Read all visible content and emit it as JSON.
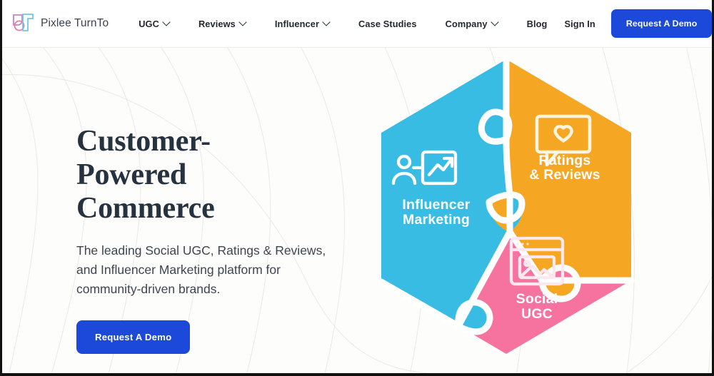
{
  "brand": {
    "name": "Pixlee TurnTo",
    "logo_icon": "pixlee-turnto-logo-icon"
  },
  "nav": {
    "items": [
      {
        "label": "UGC",
        "has_dropdown": true
      },
      {
        "label": "Reviews",
        "has_dropdown": true
      },
      {
        "label": "Influencer",
        "has_dropdown": true
      },
      {
        "label": "Case Studies",
        "has_dropdown": false
      },
      {
        "label": "Company",
        "has_dropdown": true
      },
      {
        "label": "Blog",
        "has_dropdown": false
      }
    ],
    "sign_in": "Sign In",
    "cta": "Request A Demo"
  },
  "hero": {
    "title_line1": "Customer-Powered",
    "title_line2": "Commerce",
    "subtitle": "The leading Social UGC, Ratings & Reviews, and Influencer Marketing platform for community-driven brands.",
    "cta": "Request A Demo"
  },
  "graphic": {
    "name": "hexagon-puzzle-diagram",
    "pieces": [
      {
        "id": "influencer",
        "label_line1": "Influencer",
        "label_line2": "Marketing",
        "color": "#38BCE4",
        "icon": "person-growth-arrow-icon"
      },
      {
        "id": "ratings",
        "label_line1": "Ratings",
        "label_line2": "& Reviews",
        "color": "#F5A623",
        "icon": "speech-bubble-heart-icon"
      },
      {
        "id": "social-ugc",
        "label_line1": "Social",
        "label_line2": "UGC",
        "color": "#F7739F",
        "icon": "browser-image-icon"
      }
    ]
  },
  "colors": {
    "brand_blue": "#1D49DB",
    "text_dark": "#232830",
    "title_navy": "#26323f",
    "piece_blue": "#38BCE4",
    "piece_orange": "#F5A623",
    "piece_pink": "#F7739F",
    "hero_bg": "#fdfdfc"
  }
}
